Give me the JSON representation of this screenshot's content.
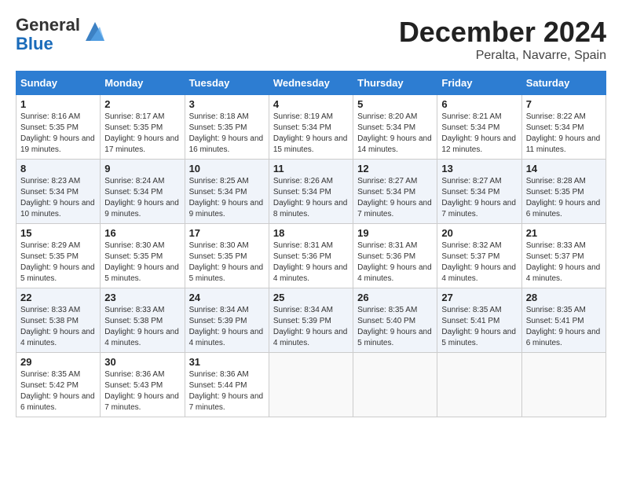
{
  "header": {
    "logo_general": "General",
    "logo_blue": "Blue",
    "month_title": "December 2024",
    "location": "Peralta, Navarre, Spain"
  },
  "days_of_week": [
    "Sunday",
    "Monday",
    "Tuesday",
    "Wednesday",
    "Thursday",
    "Friday",
    "Saturday"
  ],
  "weeks": [
    [
      {
        "day": "1",
        "sunrise": "8:16 AM",
        "sunset": "5:35 PM",
        "daylight": "9 hours and 19 minutes."
      },
      {
        "day": "2",
        "sunrise": "8:17 AM",
        "sunset": "5:35 PM",
        "daylight": "9 hours and 17 minutes."
      },
      {
        "day": "3",
        "sunrise": "8:18 AM",
        "sunset": "5:35 PM",
        "daylight": "9 hours and 16 minutes."
      },
      {
        "day": "4",
        "sunrise": "8:19 AM",
        "sunset": "5:34 PM",
        "daylight": "9 hours and 15 minutes."
      },
      {
        "day": "5",
        "sunrise": "8:20 AM",
        "sunset": "5:34 PM",
        "daylight": "9 hours and 14 minutes."
      },
      {
        "day": "6",
        "sunrise": "8:21 AM",
        "sunset": "5:34 PM",
        "daylight": "9 hours and 12 minutes."
      },
      {
        "day": "7",
        "sunrise": "8:22 AM",
        "sunset": "5:34 PM",
        "daylight": "9 hours and 11 minutes."
      }
    ],
    [
      {
        "day": "8",
        "sunrise": "8:23 AM",
        "sunset": "5:34 PM",
        "daylight": "9 hours and 10 minutes."
      },
      {
        "day": "9",
        "sunrise": "8:24 AM",
        "sunset": "5:34 PM",
        "daylight": "9 hours and 9 minutes."
      },
      {
        "day": "10",
        "sunrise": "8:25 AM",
        "sunset": "5:34 PM",
        "daylight": "9 hours and 9 minutes."
      },
      {
        "day": "11",
        "sunrise": "8:26 AM",
        "sunset": "5:34 PM",
        "daylight": "9 hours and 8 minutes."
      },
      {
        "day": "12",
        "sunrise": "8:27 AM",
        "sunset": "5:34 PM",
        "daylight": "9 hours and 7 minutes."
      },
      {
        "day": "13",
        "sunrise": "8:27 AM",
        "sunset": "5:34 PM",
        "daylight": "9 hours and 7 minutes."
      },
      {
        "day": "14",
        "sunrise": "8:28 AM",
        "sunset": "5:35 PM",
        "daylight": "9 hours and 6 minutes."
      }
    ],
    [
      {
        "day": "15",
        "sunrise": "8:29 AM",
        "sunset": "5:35 PM",
        "daylight": "9 hours and 5 minutes."
      },
      {
        "day": "16",
        "sunrise": "8:30 AM",
        "sunset": "5:35 PM",
        "daylight": "9 hours and 5 minutes."
      },
      {
        "day": "17",
        "sunrise": "8:30 AM",
        "sunset": "5:35 PM",
        "daylight": "9 hours and 5 minutes."
      },
      {
        "day": "18",
        "sunrise": "8:31 AM",
        "sunset": "5:36 PM",
        "daylight": "9 hours and 4 minutes."
      },
      {
        "day": "19",
        "sunrise": "8:31 AM",
        "sunset": "5:36 PM",
        "daylight": "9 hours and 4 minutes."
      },
      {
        "day": "20",
        "sunrise": "8:32 AM",
        "sunset": "5:37 PM",
        "daylight": "9 hours and 4 minutes."
      },
      {
        "day": "21",
        "sunrise": "8:33 AM",
        "sunset": "5:37 PM",
        "daylight": "9 hours and 4 minutes."
      }
    ],
    [
      {
        "day": "22",
        "sunrise": "8:33 AM",
        "sunset": "5:38 PM",
        "daylight": "9 hours and 4 minutes."
      },
      {
        "day": "23",
        "sunrise": "8:33 AM",
        "sunset": "5:38 PM",
        "daylight": "9 hours and 4 minutes."
      },
      {
        "day": "24",
        "sunrise": "8:34 AM",
        "sunset": "5:39 PM",
        "daylight": "9 hours and 4 minutes."
      },
      {
        "day": "25",
        "sunrise": "8:34 AM",
        "sunset": "5:39 PM",
        "daylight": "9 hours and 4 minutes."
      },
      {
        "day": "26",
        "sunrise": "8:35 AM",
        "sunset": "5:40 PM",
        "daylight": "9 hours and 5 minutes."
      },
      {
        "day": "27",
        "sunrise": "8:35 AM",
        "sunset": "5:41 PM",
        "daylight": "9 hours and 5 minutes."
      },
      {
        "day": "28",
        "sunrise": "8:35 AM",
        "sunset": "5:41 PM",
        "daylight": "9 hours and 6 minutes."
      }
    ],
    [
      {
        "day": "29",
        "sunrise": "8:35 AM",
        "sunset": "5:42 PM",
        "daylight": "9 hours and 6 minutes."
      },
      {
        "day": "30",
        "sunrise": "8:36 AM",
        "sunset": "5:43 PM",
        "daylight": "9 hours and 7 minutes."
      },
      {
        "day": "31",
        "sunrise": "8:36 AM",
        "sunset": "5:44 PM",
        "daylight": "9 hours and 7 minutes."
      },
      null,
      null,
      null,
      null
    ]
  ]
}
